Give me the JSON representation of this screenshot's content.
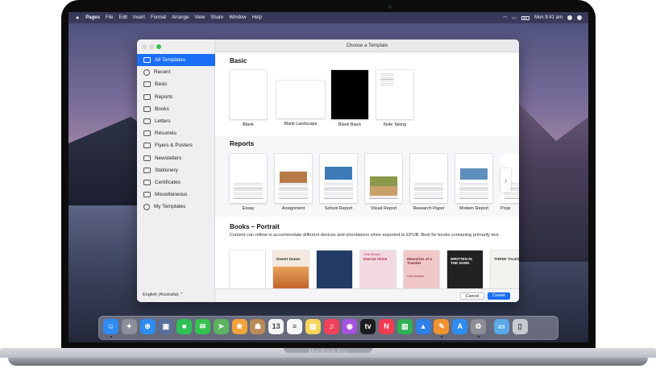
{
  "device_label": "MacBook Pro",
  "menubar": {
    "app_name": "Pages",
    "items": [
      "File",
      "Edit",
      "Insert",
      "Format",
      "Arrange",
      "View",
      "Share",
      "Window",
      "Help"
    ],
    "clock": "Mon 9:41 am"
  },
  "window": {
    "title": "Choose a Template",
    "sidebar": {
      "items": [
        {
          "label": "All Templates",
          "icon": "all-templates-icon"
        },
        {
          "label": "Recent",
          "icon": "clock-icon"
        },
        {
          "label": "Basic",
          "icon": "document-icon"
        },
        {
          "label": "Reports",
          "icon": "report-icon"
        },
        {
          "label": "Books",
          "icon": "book-icon"
        },
        {
          "label": "Letters",
          "icon": "letter-icon"
        },
        {
          "label": "Résumés",
          "icon": "resume-icon"
        },
        {
          "label": "Flyers & Posters",
          "icon": "flyer-icon"
        },
        {
          "label": "Newsletters",
          "icon": "newsletter-icon"
        },
        {
          "label": "Stationery",
          "icon": "stationery-icon"
        },
        {
          "label": "Certificates",
          "icon": "certificate-icon"
        },
        {
          "label": "Miscellaneous",
          "icon": "miscellaneous-icon"
        },
        {
          "label": "My Templates",
          "icon": "heart-icon"
        }
      ],
      "selected_index": 0,
      "language": "English (Australia) ⌃"
    },
    "sections": {
      "basic": {
        "title": "Basic",
        "templates": [
          "Blank",
          "Blank Landscape",
          "Blank Black",
          "Note Taking"
        ]
      },
      "reports": {
        "title": "Reports",
        "templates": [
          "Essay",
          "Assignment",
          "School Report",
          "Visual Report",
          "Research Paper",
          "Modern Report",
          "Proje"
        ]
      },
      "books": {
        "title": "Books – Portrait",
        "description": "Content can reflow to accommodate different devices and orientations when exported to EPUB. Best for books containing primarily text.",
        "covers": [
          {
            "title": "",
            "bg": "#ffffff"
          },
          {
            "title": "Desert Dunes",
            "bg": "#f4e9dd"
          },
          {
            "title": "",
            "bg": "#223a66"
          },
          {
            "title": "Eternal Shine",
            "bg": "#f3d9e2"
          },
          {
            "title": "Memories of a Traveler",
            "bg": "#f1c7c7"
          },
          {
            "title": "WRITTEN IN THE DARK",
            "bg": "#222222"
          },
          {
            "title": "THREE TALES",
            "bg": "#f2f2ee"
          }
        ],
        "author": "Urna Semper"
      }
    },
    "footer": {
      "cancel_label": "Cancel",
      "create_label": "Create"
    }
  },
  "dock": [
    {
      "name": "finder-icon",
      "color": "#2f8cf2",
      "glyph": "☺"
    },
    {
      "name": "launchpad-icon",
      "color": "#8a8f99",
      "glyph": "✦"
    },
    {
      "name": "safari-icon",
      "color": "#2d8cf0",
      "glyph": "⊕"
    },
    {
      "name": "photo-booth-icon",
      "color": "#5a6e9a",
      "glyph": "▣"
    },
    {
      "name": "facetime-icon",
      "color": "#2fc158",
      "glyph": "■"
    },
    {
      "name": "messages-icon",
      "color": "#35c24f",
      "glyph": "✉"
    },
    {
      "name": "maps-icon",
      "color": "#5bb35f",
      "glyph": "➤"
    },
    {
      "name": "photos-icon",
      "color": "#f0a23b",
      "glyph": "❀"
    },
    {
      "name": "contacts-icon",
      "color": "#b98a58",
      "glyph": "☗"
    },
    {
      "name": "calendar-icon",
      "color": "#f4f4f4",
      "glyph": "13"
    },
    {
      "name": "reminders-icon",
      "color": "#f6f6f6",
      "glyph": "≡"
    },
    {
      "name": "notes-icon",
      "color": "#f6d45b",
      "glyph": "▤"
    },
    {
      "name": "music-icon",
      "color": "#f0415b",
      "glyph": "♫"
    },
    {
      "name": "podcasts-icon",
      "color": "#a553de",
      "glyph": "◉"
    },
    {
      "name": "apple-tv-icon",
      "color": "#1d1d1f",
      "glyph": "tv"
    },
    {
      "name": "news-icon",
      "color": "#f23c51",
      "glyph": "N"
    },
    {
      "name": "numbers-icon",
      "color": "#2fb155",
      "glyph": "▥"
    },
    {
      "name": "keynote-icon",
      "color": "#2e7fe6",
      "glyph": "▲"
    },
    {
      "name": "pages-icon",
      "color": "#f3932f",
      "glyph": "✎"
    },
    {
      "name": "app-store-icon",
      "color": "#2d8cf0",
      "glyph": "A"
    },
    {
      "name": "system-preferences-icon",
      "color": "#8d8f96",
      "glyph": "⚙"
    },
    {
      "name": "downloads-folder-icon",
      "color": "#59a8e8",
      "glyph": "▭"
    },
    {
      "name": "trash-icon",
      "color": "#c6c9cf",
      "glyph": "▯"
    }
  ]
}
